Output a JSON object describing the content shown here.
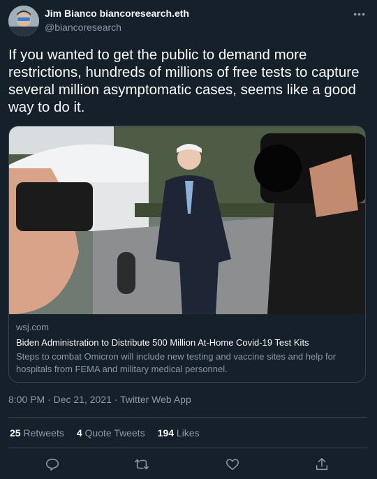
{
  "author": {
    "display_name": "Jim Bianco biancoresearch.eth",
    "handle": "@biancoresearch"
  },
  "tweet": {
    "text": "If you wanted to get the public to demand more restrictions, hundreds of millions of free tests to capture several million asymptomatic cases, seems like a good way to do it."
  },
  "card": {
    "domain": "wsj.com",
    "title": "Biden Administration to Distribute 500 Million At-Home Covid-19 Test Kits",
    "description": "Steps to combat Omicron will include new testing and vaccine sites and help for hospitals from FEMA and military medical personnel."
  },
  "meta": {
    "timestamp": "8:00 PM · Dec 21, 2021 · Twitter Web App"
  },
  "stats": {
    "retweets_count": "25",
    "retweets_label": "Retweets",
    "quotes_count": "4",
    "quotes_label": "Quote Tweets",
    "likes_count": "194",
    "likes_label": "Likes"
  },
  "actions": [
    "reply-icon",
    "retweet-icon",
    "like-icon",
    "share-icon"
  ],
  "colors": {
    "background": "#15202b",
    "text": "#f7f9f9",
    "secondary": "#8b98a5",
    "border": "#38444d"
  }
}
